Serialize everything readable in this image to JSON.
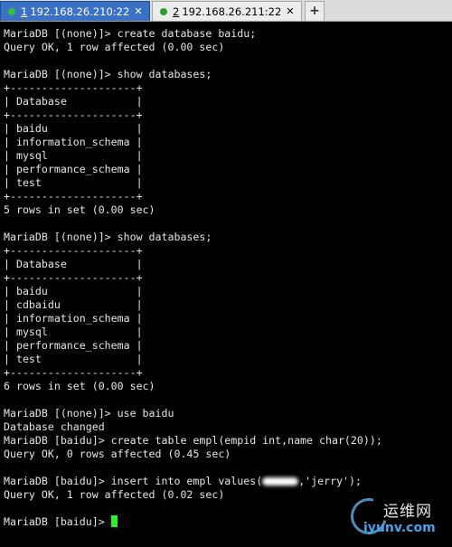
{
  "tabs": [
    {
      "number": "1",
      "label": "192.168.26.210:22",
      "close": "✕",
      "active": true
    },
    {
      "number": "2",
      "label": "192.168.26.211:22",
      "close": "✕",
      "active": false
    }
  ],
  "new_tab_label": "+",
  "terminal": {
    "lines": [
      "MariaDB [(none)]> create database baidu;",
      "Query OK, 1 row affected (0.00 sec)",
      "",
      "MariaDB [(none)]> show databases;",
      "+--------------------+",
      "| Database           |",
      "+--------------------+",
      "| baidu              |",
      "| information_schema |",
      "| mysql              |",
      "| performance_schema |",
      "| test               |",
      "+--------------------+",
      "5 rows in set (0.00 sec)",
      "",
      "MariaDB [(none)]> show databases;",
      "+--------------------+",
      "| Database           |",
      "+--------------------+",
      "| baidu              |",
      "| cdbaidu            |",
      "| information_schema |",
      "| mysql              |",
      "| performance_schema |",
      "| test               |",
      "+--------------------+",
      "6 rows in set (0.00 sec)",
      "",
      "MariaDB [(none)]> use baidu",
      "Database changed",
      "MariaDB [baidu]> create table empl(empid int,name char(20));",
      "Query OK, 0 rows affected (0.45 sec)",
      "",
      "MariaDB [baidu]> insert into empl values("
    ],
    "insert_suffix": ",'jerry');",
    "after_insert": [
      "Query OK, 1 row affected (0.02 sec)",
      ""
    ],
    "prompt": "MariaDB [baidu]> "
  },
  "colors": {
    "background": "#000000",
    "text": "#e6e6e6",
    "cursor": "#2cf02c",
    "active_tab": "#3a71c4"
  },
  "watermark": {
    "chinese": "运维网",
    "domain": "iyunv.com"
  }
}
